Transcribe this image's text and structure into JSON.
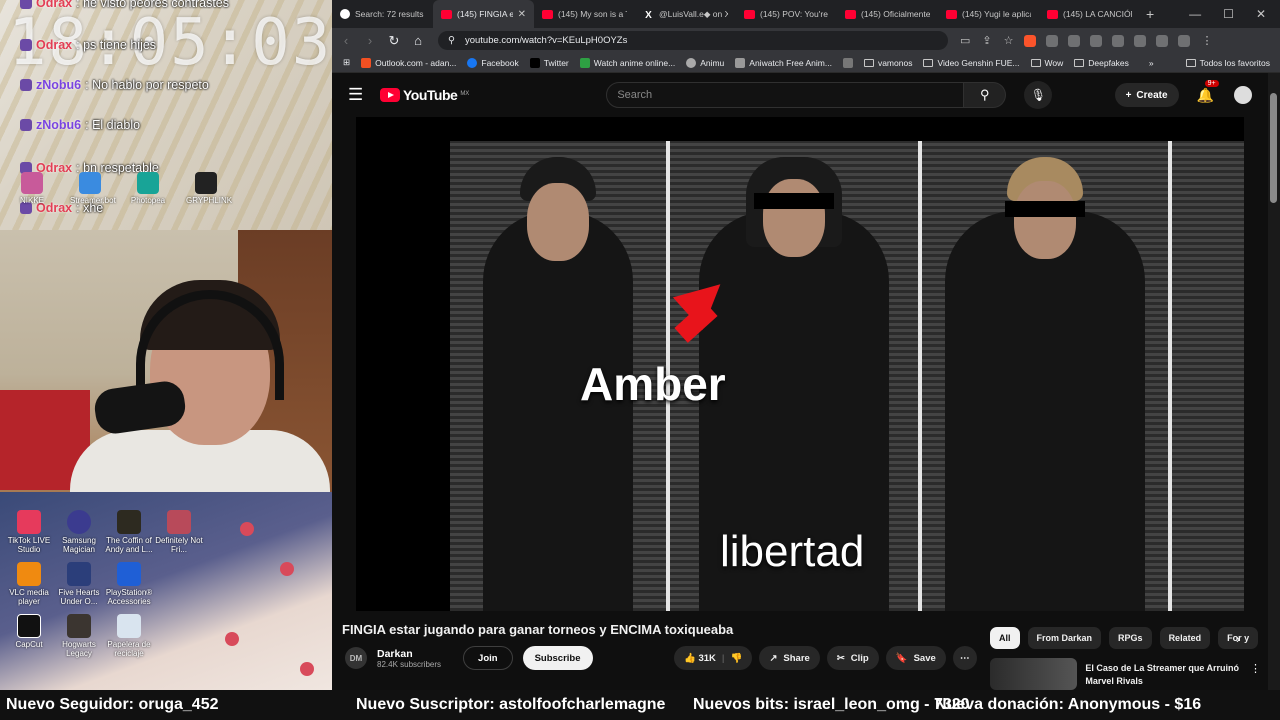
{
  "overlay": {
    "clock": "18:05:03",
    "chat": [
      {
        "user": "Odrax",
        "msg": "ne visto peores contrastes"
      },
      {
        "user": "Odrax",
        "msg": "ps tiene hijes"
      },
      {
        "user": "zNobu6",
        "msg": "No hablo por respeto"
      },
      {
        "user": "zNobu6",
        "msg": "El diablo"
      },
      {
        "user": "Odrax",
        "msg": "bn respetable"
      },
      {
        "user": "Odrax",
        "msg": "xhe"
      }
    ],
    "top_icons": [
      "NIKKE",
      "Streamer.bot",
      "Photopea",
      "GRYPHLINK"
    ],
    "desktop_icons": [
      "TikTok LIVE Studio",
      "Samsung Magician",
      "The Coffin of Andy and L...",
      "Definitely Not Fri...",
      "VLC media player",
      "Five Hearts Under O...",
      "PlayStation® Accessories",
      "",
      "CapCut",
      "Hogwarts Legacy",
      "Papelera de reciclaje",
      ""
    ]
  },
  "browser": {
    "tabs": [
      {
        "label": "Search: 72 results f",
        "icon": "globe"
      },
      {
        "label": "(145) FINGIA e",
        "icon": "youtube",
        "active": true
      },
      {
        "label": "(145) My son is a T",
        "icon": "youtube"
      },
      {
        "label": "@LuisVall.e◆ on X",
        "icon": "x"
      },
      {
        "label": "(145) POV: You're a",
        "icon": "youtube"
      },
      {
        "label": "(145) Oficialmente",
        "icon": "youtube"
      },
      {
        "label": "(145) Yugi le aplica",
        "icon": "youtube"
      },
      {
        "label": "(145) LA CANCIÓN",
        "icon": "youtube"
      }
    ],
    "url": "youtube.com/watch?v=KEuLpH0OYZs",
    "bookmarks": [
      "Outlook.com - adan...",
      "Facebook",
      "Twitter",
      "Watch anime online...",
      "Animu",
      "Aniwatch Free Anim...",
      "",
      "vamonos",
      "Video Genshin FUE...",
      "Wow",
      "Deepfakes"
    ],
    "all_bookmarks": "Todos los favoritos"
  },
  "youtube": {
    "logo": "YouTube",
    "region": "MX",
    "search_placeholder": "Search",
    "create": "Create",
    "notif_count": "9+",
    "video": {
      "caption_name": "Amber",
      "caption_word": "libertad",
      "title": "FINGIA estar jugando para ganar torneos y ENCIMA toxiqueaba"
    },
    "channel": {
      "initials": "DM",
      "name": "Darkan",
      "subs": "82.4K subscribers",
      "join": "Join",
      "subscribe": "Subscribe"
    },
    "actions": {
      "likes": "31K",
      "share": "Share",
      "clip": "Clip",
      "save": "Save"
    },
    "chips": [
      "All",
      "From Darkan",
      "RPGs",
      "Related",
      "For y"
    ],
    "rec_title": "El Caso de La Streamer que Arruinó Marvel Rivals"
  },
  "ticker": {
    "follower": "Nuevo Seguidor: oruga_452",
    "subscriber": "Nuevo Suscriptor: astolfoofcharlemagne",
    "bits": "Nuevos bits: israel_leon_omg - 7320",
    "tip": "Nueva donación: Anonymous - $16"
  },
  "colors": {
    "youtube_red": "#ff0033",
    "chat_red": "#e33e55",
    "chat_purple": "#7a45e0",
    "arrow": "#e8141b"
  }
}
